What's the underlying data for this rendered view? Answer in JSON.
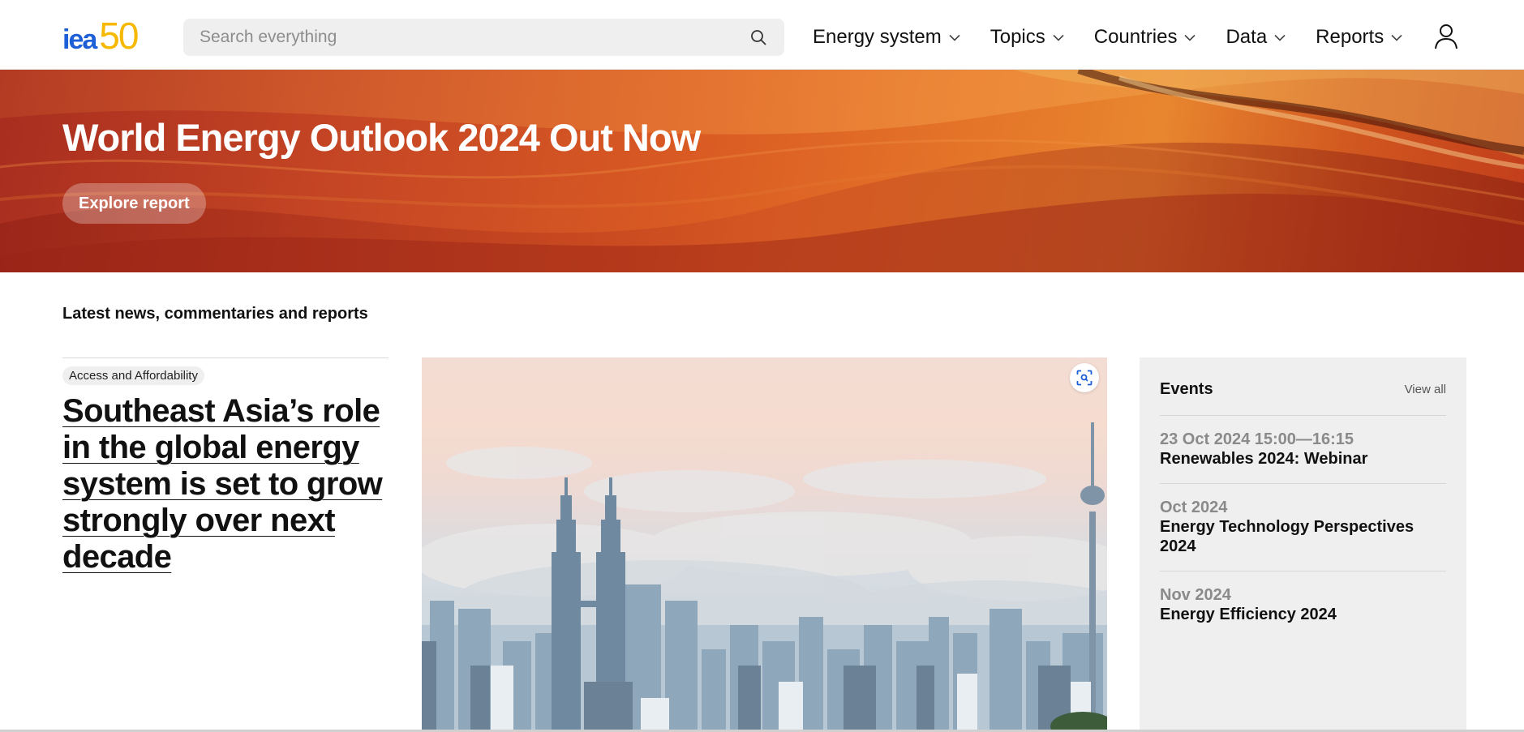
{
  "header": {
    "logo_text_a": "iea",
    "logo_text_b": "50",
    "search_placeholder": "Search everything",
    "nav": [
      {
        "label": "Energy system"
      },
      {
        "label": "Topics"
      },
      {
        "label": "Countries"
      },
      {
        "label": "Data"
      },
      {
        "label": "Reports"
      }
    ]
  },
  "hero": {
    "title": "World Energy Outlook 2024 Out Now",
    "button_label": "Explore report"
  },
  "latest": {
    "section_title": "Latest news, commentaries and reports",
    "feature": {
      "tag": "Access and Affordability",
      "title_lines": [
        "Southeast Asia’s role",
        "in the global energy",
        "system is set to grow",
        "strongly over next",
        "decade"
      ]
    }
  },
  "events": {
    "title": "Events",
    "view_all": "View all",
    "items": [
      {
        "date": "23 Oct 2024 15:00—16:15",
        "name": "Renewables 2024: Webinar"
      },
      {
        "date": "Oct 2024",
        "name": "Energy Technology Perspectives 2024"
      },
      {
        "date": "Nov 2024",
        "name": "Energy Efficiency 2024"
      }
    ]
  },
  "colors": {
    "brand_blue": "#1d5fd6",
    "brand_yellow": "#f6b800",
    "hero_orange": "#d95a23"
  },
  "icons": {
    "search": "search-icon",
    "chevron": "chevron-down-icon",
    "user": "user-icon",
    "zoom": "image-zoom-icon"
  }
}
